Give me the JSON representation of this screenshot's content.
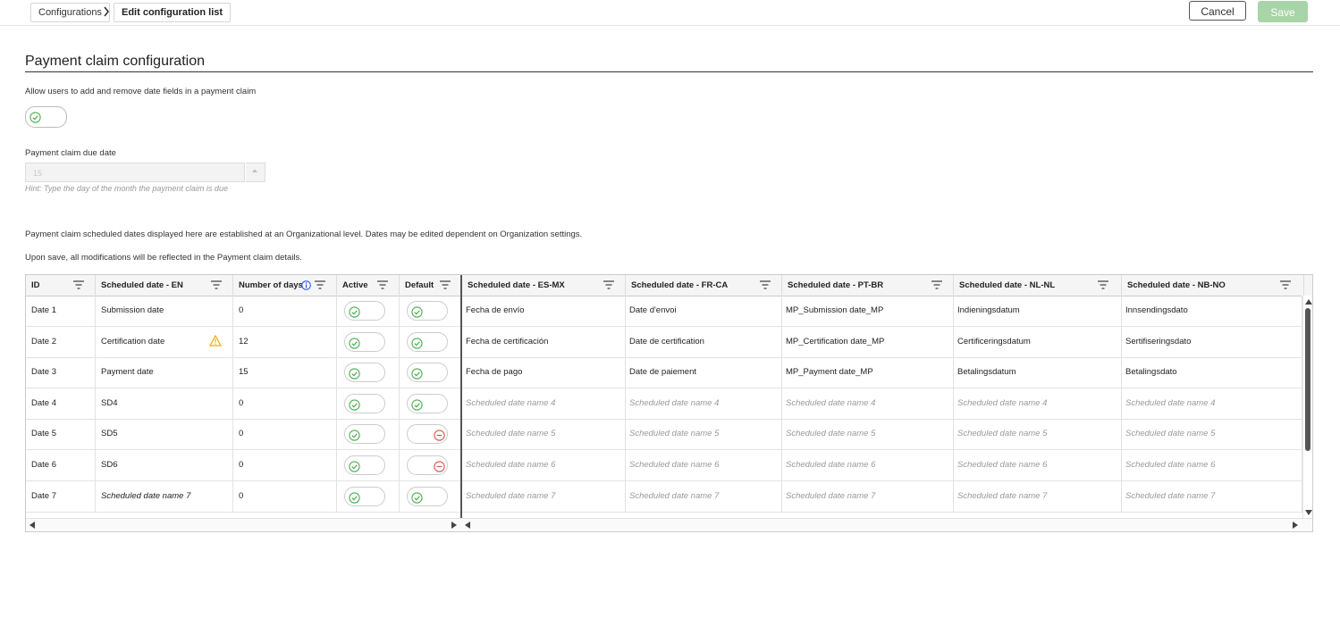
{
  "breadcrumb": {
    "item1": "Configurations",
    "item2": "Edit configuration list"
  },
  "toolbar": {
    "cancel_label": "Cancel",
    "save_label": "Save"
  },
  "section": {
    "title": "Payment claim configuration"
  },
  "allow_toggle": {
    "label": "Allow users to add and remove date fields in a payment claim",
    "state": "on"
  },
  "due_date": {
    "label": "Payment claim due date",
    "value": "15",
    "hint": "Hint: Type the day of the month the payment claim is due"
  },
  "notes": {
    "line1": "Payment claim scheduled dates displayed here are established at an Organizational level. Dates may be edited dependent on Organization settings.",
    "line2": "Upon save, all modifications will be reflected in the Payment claim details."
  },
  "table": {
    "headers": {
      "id": "ID",
      "en": "Scheduled date - EN",
      "days": "Number of days",
      "active": "Active",
      "default": "Default",
      "esmx": "Scheduled date - ES-MX",
      "frca": "Scheduled date - FR-CA",
      "ptbr": "Scheduled date - PT-BR",
      "nlnl": "Scheduled date - NL-NL",
      "nbno": "Scheduled date - NB-NO"
    },
    "rows": [
      {
        "id": "Date 1",
        "en": "Submission date",
        "days": "0",
        "esmx": "Fecha de envío",
        "frca": "Date d'envoi",
        "ptbr": "MP_Submission date_MP",
        "nlnl": "Indieningsdatum",
        "nbno": "Innsendingsdato"
      },
      {
        "id": "Date 2",
        "en": "Certification date",
        "days": "12",
        "esmx": "Fecha de certificación",
        "frca": "Date de certification",
        "ptbr": "MP_Certification date_MP",
        "nlnl": "Certificeringsdatum",
        "nbno": "Sertifiseringsdato"
      },
      {
        "id": "Date 3",
        "en": "Payment date",
        "days": "15",
        "esmx": "Fecha de pago",
        "frca": "Date de paiement",
        "ptbr": "MP_Payment date_MP",
        "nlnl": "Betalingsdatum",
        "nbno": "Betalingsdato"
      },
      {
        "id": "Date 4",
        "en": "SD4",
        "days": "0",
        "esmx": "Scheduled date name 4",
        "frca": "Scheduled date name 4",
        "ptbr": "Scheduled date name 4",
        "nlnl": "Scheduled date name 4",
        "nbno": "Scheduled date name 4"
      },
      {
        "id": "Date 5",
        "en": "SD5",
        "days": "0",
        "esmx": "Scheduled date name 5",
        "frca": "Scheduled date name 5",
        "ptbr": "Scheduled date name 5",
        "nlnl": "Scheduled date name 5",
        "nbno": "Scheduled date name 5"
      },
      {
        "id": "Date 6",
        "en": "SD6",
        "days": "0",
        "esmx": "Scheduled date name 6",
        "frca": "Scheduled date name 6",
        "ptbr": "Scheduled date name 6",
        "nlnl": "Scheduled date name 6",
        "nbno": "Scheduled date name 6"
      },
      {
        "id": "Date 7",
        "en": "Scheduled date name 7",
        "days": "0",
        "esmx": "Scheduled date name 7",
        "frca": "Scheduled date name 7",
        "ptbr": "Scheduled date name 7",
        "nlnl": "Scheduled date name 7",
        "nbno": "Scheduled date name 7"
      }
    ]
  },
  "colors": {
    "accent_green": "#4caf50",
    "save_disabled": "#a8d5a8",
    "default_off_red": "#d9534f",
    "warning": "#f0ad00",
    "info_blue": "#1a56db"
  }
}
